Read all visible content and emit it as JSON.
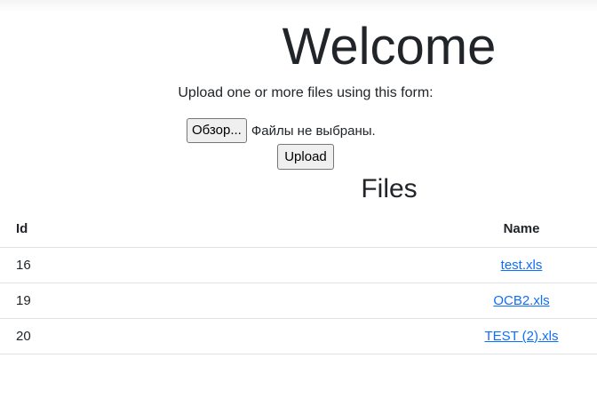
{
  "header": {
    "title": "Welcome",
    "intro": "Upload one or more files using this form:"
  },
  "upload_form": {
    "browse_label": "Обзор...",
    "no_file_text": "Файлы не выбраны.",
    "upload_label": "Upload"
  },
  "files_section": {
    "title": "Files",
    "columns": [
      "Id",
      "Name"
    ],
    "rows": [
      {
        "id": "16",
        "name": "test.xls"
      },
      {
        "id": "19",
        "name": "OCB2.xls"
      },
      {
        "id": "20",
        "name": "TEST (2).xls"
      }
    ]
  }
}
